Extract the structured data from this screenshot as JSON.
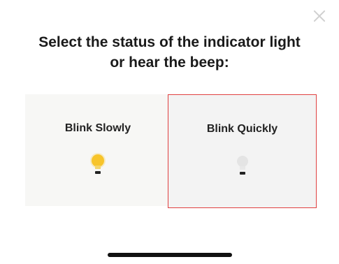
{
  "dialog": {
    "close_icon": "close-icon",
    "title_line1": "Select the status of the indicator light",
    "title_line2": "or hear the beep:"
  },
  "options": [
    {
      "label": "Blink Slowly",
      "icon": "bulb-lit-icon",
      "bulb_color": "#f7c52a",
      "selected": false
    },
    {
      "label": "Blink Quickly",
      "icon": "bulb-off-icon",
      "bulb_color": "#e6e6e6",
      "selected": true
    }
  ],
  "colors": {
    "selection_border": "#e04040",
    "home_indicator": "#111111"
  }
}
